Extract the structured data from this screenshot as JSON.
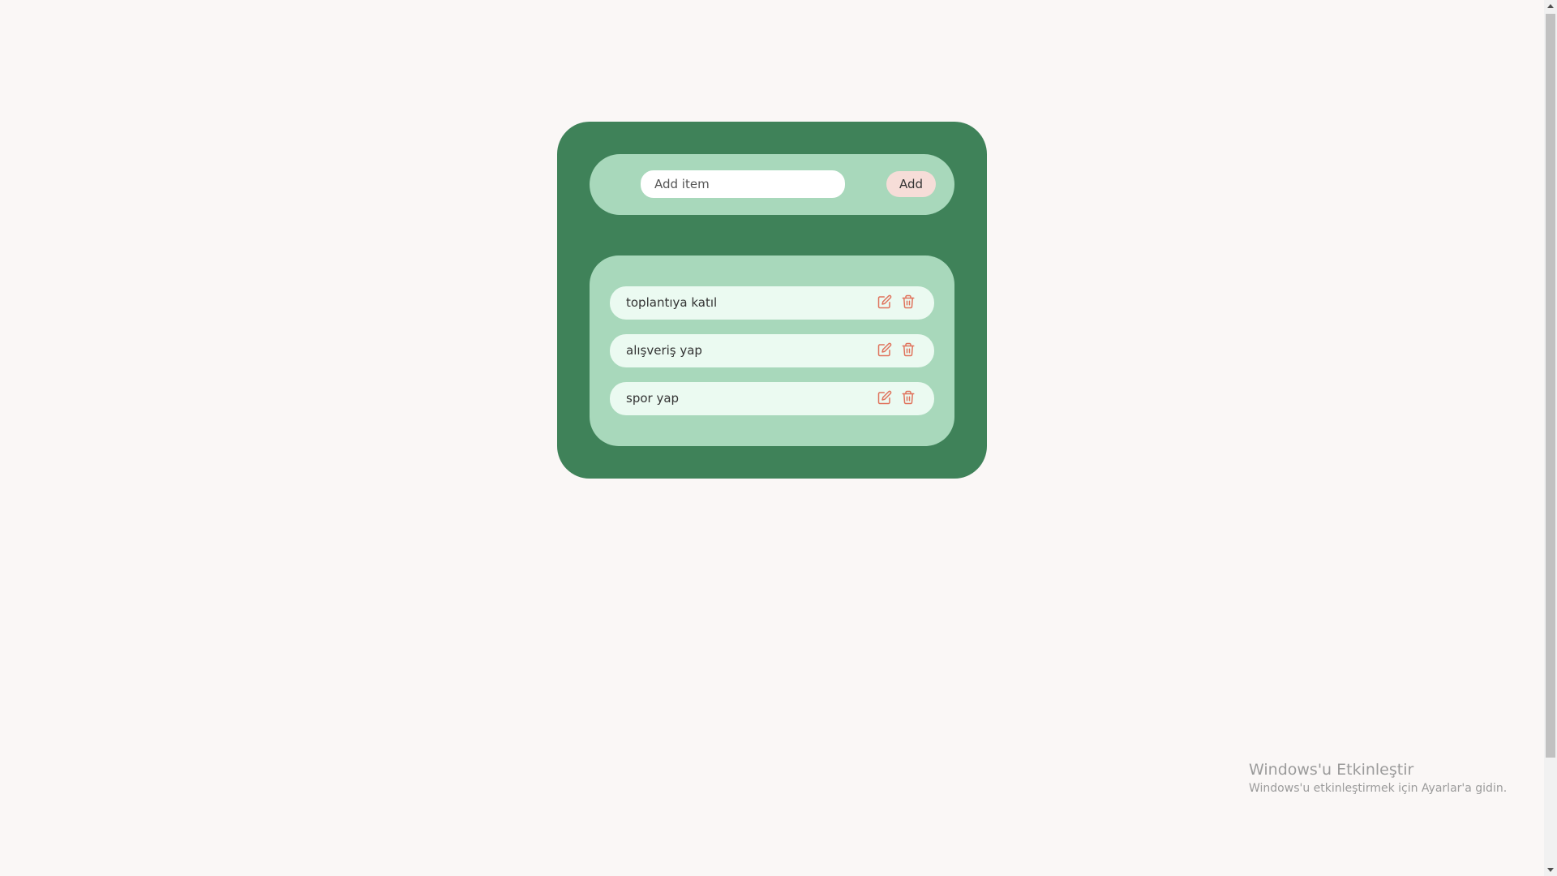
{
  "form": {
    "input_placeholder": "Add item",
    "input_value": "",
    "add_label": "Add"
  },
  "todos": [
    {
      "text": "toplantıya katıl",
      "edit_icon": "edit-icon",
      "delete_icon": "trash-icon"
    },
    {
      "text": "alışveriş yap",
      "edit_icon": "edit-icon",
      "delete_icon": "trash-icon"
    },
    {
      "text": "spor yap",
      "edit_icon": "edit-icon",
      "delete_icon": "trash-icon"
    }
  ],
  "watermark": {
    "title": "Windows'u Etkinleştir",
    "subtitle": "Windows'u etkinleştirmek için Ayarlar'a gidin."
  },
  "colors": {
    "background": "#faf7f6",
    "card": "#3f8259",
    "panel": "#a8d8bb",
    "item": "#ebfaf1",
    "button": "#f6ddd8",
    "icon": "#e0735c"
  }
}
